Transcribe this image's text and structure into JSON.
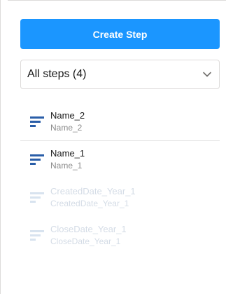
{
  "toolbar": {
    "create_label": "Create Step"
  },
  "filter": {
    "selected": "All steps (4)"
  },
  "steps": [
    {
      "name": "Name_2",
      "sub": "Name_2"
    },
    {
      "name": "Name_1",
      "sub": "Name_1"
    },
    {
      "name": "CreatedDate_Year_1",
      "sub": "CreatedDate_Year_1"
    },
    {
      "name": "CloseDate_Year_1",
      "sub": "CloseDate_Year_1"
    }
  ],
  "colors": {
    "accent": "#1b96ff",
    "icon": "#2a5ea8",
    "faded_text": "#d4dce6"
  },
  "icons": {
    "step": "lines-icon",
    "dropdown": "chevron-down-icon"
  }
}
